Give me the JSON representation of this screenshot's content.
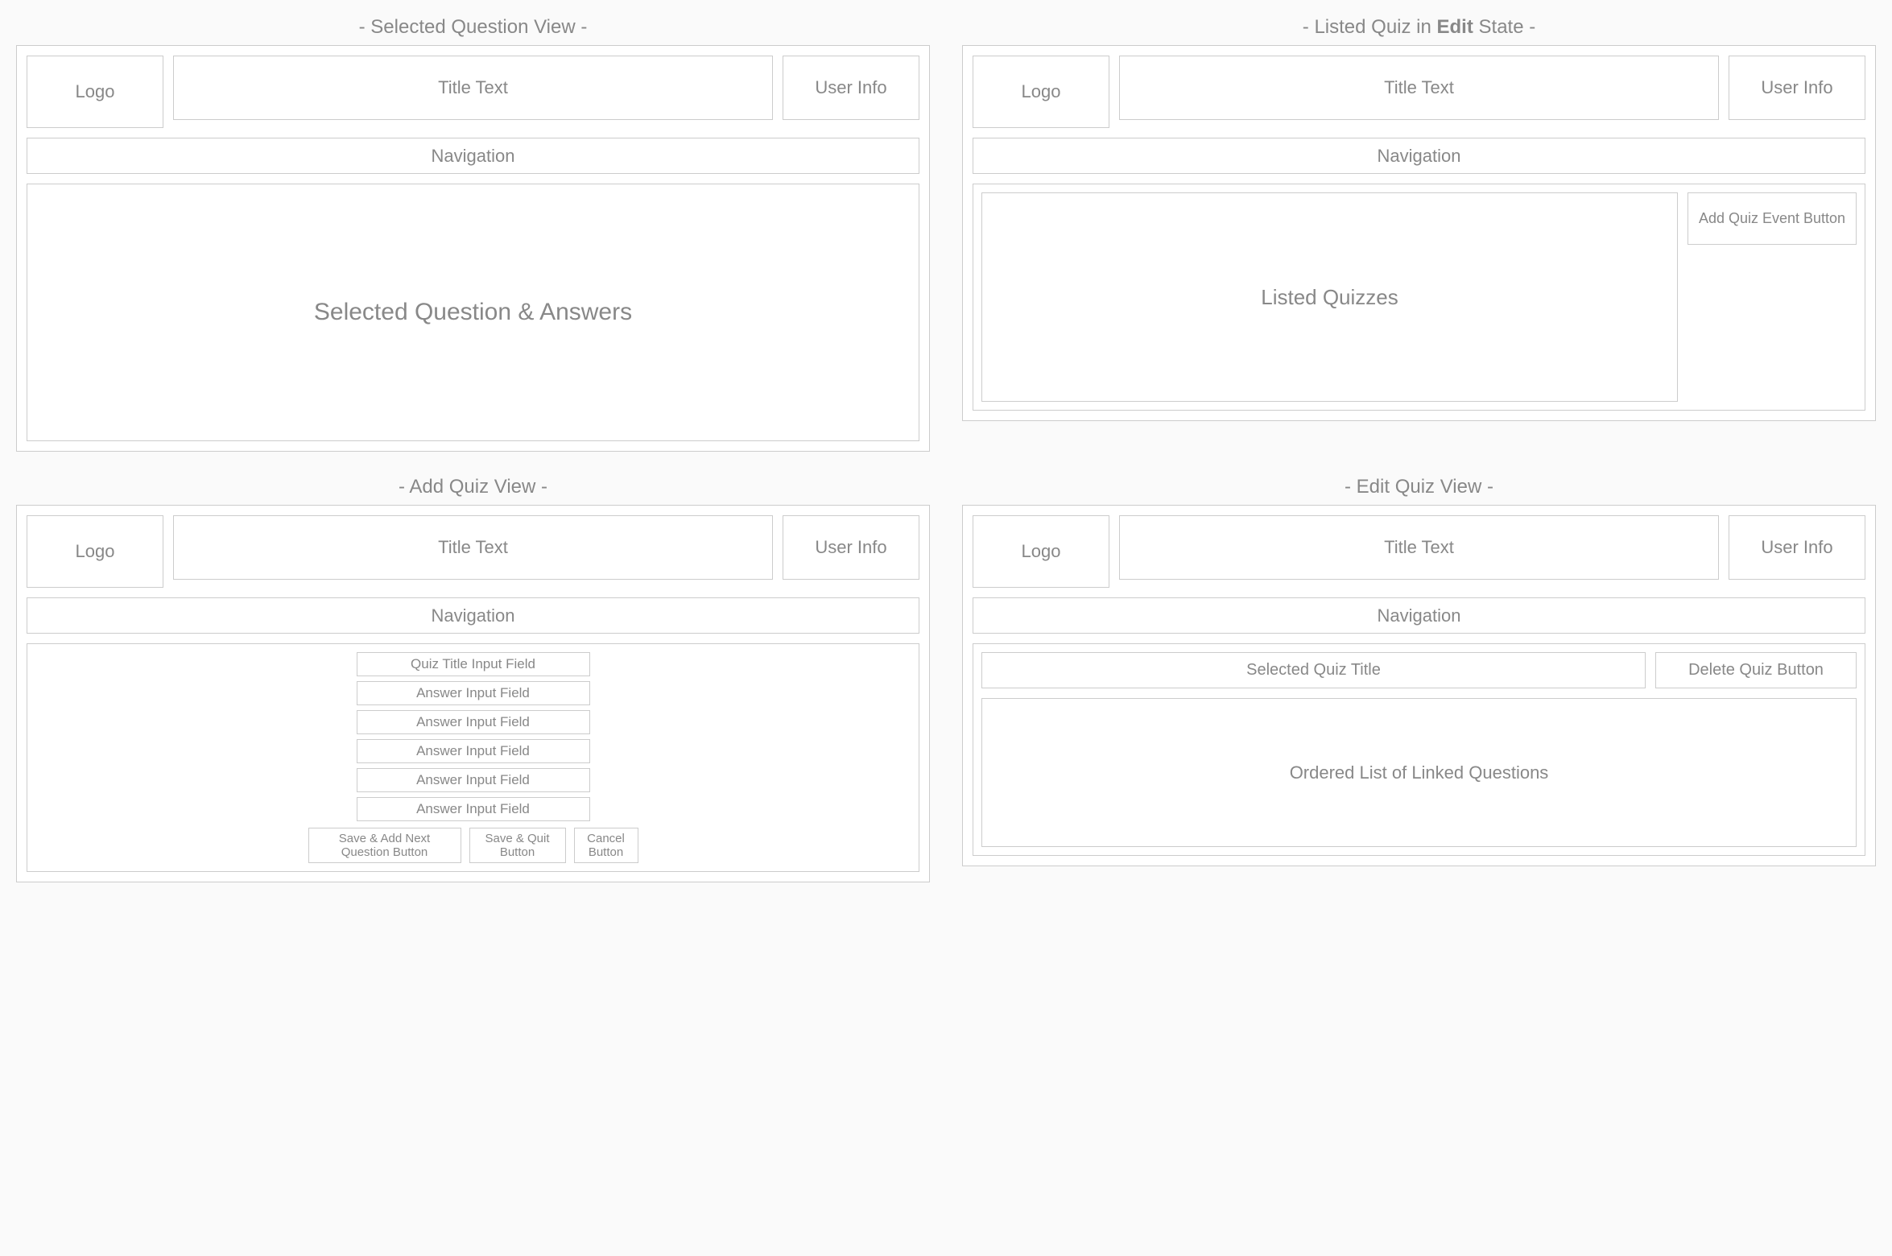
{
  "panels": {
    "selected_question": {
      "title_prefix": "-  Selected Question View  -",
      "logo": "Logo",
      "title": "Title Text",
      "userinfo": "User Info",
      "nav": "Navigation",
      "main": "Selected Question & Answers"
    },
    "listed_quiz_edit": {
      "title_prefix": "-  Listed Quiz in ",
      "title_bold": "Edit",
      "title_suffix": " State  -",
      "logo": "Logo",
      "title": "Title Text",
      "userinfo": "User Info",
      "nav": "Navigation",
      "listed": "Listed Quizzes",
      "add_btn": "Add Quiz Event Button"
    },
    "add_quiz": {
      "title_prefix": "-  Add Quiz View  -",
      "logo": "Logo",
      "title": "Title Text",
      "userinfo": "User Info",
      "nav": "Navigation",
      "quiz_title_input": "Quiz Title Input Field",
      "answer_inputs": [
        "Answer Input Field",
        "Answer Input Field",
        "Answer Input Field",
        "Answer Input Field",
        "Answer Input Field"
      ],
      "save_next": "Save & Add Next Question Button",
      "save_quit": "Save & Quit Button",
      "cancel": "Cancel Button"
    },
    "edit_quiz": {
      "title_prefix": "-  Edit Quiz View  -",
      "logo": "Logo",
      "title": "Title Text",
      "userinfo": "User Info",
      "nav": "Navigation",
      "selected_title": "Selected Quiz Title",
      "delete_btn": "Delete Quiz Button",
      "ordered_list": "Ordered List of Linked Questions"
    }
  }
}
